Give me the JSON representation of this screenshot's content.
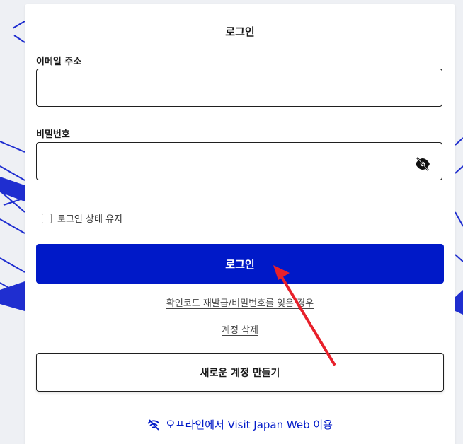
{
  "login_form": {
    "title": "로그인",
    "email_label": "이메일 주소",
    "email_value": "",
    "password_label": "비밀번호",
    "password_value": "",
    "remember_label": "로그인 상태 유지",
    "login_button": "로그인",
    "forgot_link": "확인코드 재발급/비밀번호를 잊은 경우",
    "delete_link": "계정 삭제",
    "create_button": "새로운 계정 만들기",
    "offline_link": "오프라인에서 Visit Japan Web 이용"
  },
  "icons": {
    "password_toggle": "eye-slash-icon",
    "offline": "wifi-off-icon"
  },
  "colors": {
    "primary": "#0019c8",
    "annotation_arrow": "#e8202a",
    "border": "#1f1f1f"
  }
}
